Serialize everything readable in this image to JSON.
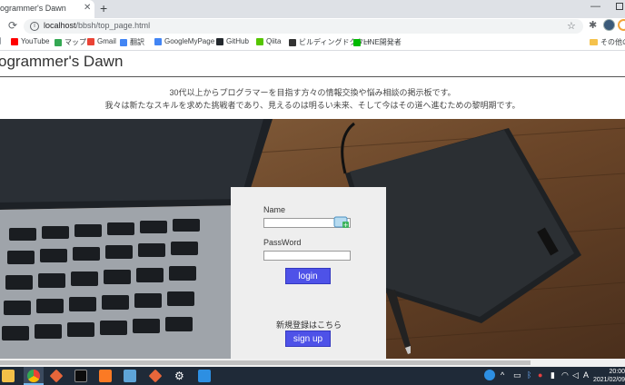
{
  "browser": {
    "tab_title": "ogrammer's Dawn",
    "tab_close": "✕",
    "new_tab": "+",
    "url_host": "localhost",
    "url_path": "/bbsh/top_page.html"
  },
  "bookmarks": [
    {
      "label": "YouTube",
      "icon_color": "#ff0000"
    },
    {
      "label": "マップ",
      "icon_color": "#34a853"
    },
    {
      "label": "Gmail",
      "icon_color": "#ea4335"
    },
    {
      "label": "翻訳",
      "icon_color": "#4285f4"
    },
    {
      "label": "GoogleMyPage",
      "icon_color": "#4285f4"
    },
    {
      "label": "GitHub",
      "icon_color": "#24292e"
    },
    {
      "label": "Qiita",
      "icon_color": "#55c500"
    },
    {
      "label": "ビルディングドクター",
      "icon_color": "#333333"
    },
    {
      "label": "LINE開発者",
      "icon_color": "#00b900"
    }
  ],
  "bookmarks_other": "その他のブ",
  "page": {
    "site_title": "ogrammer's Dawn",
    "tagline_1": "30代以上からプログラマーを目指す方々の情報交換や悩み相談の掲示板です。",
    "tagline_2": "我々は新たなスキルを求めた挑戦者であり、見えるのは明るい未来、そして今はその道へ進むための黎明期です。"
  },
  "login": {
    "name_label": "Name",
    "name_value": "",
    "password_label": "PassWord",
    "password_value": "",
    "login_button": "login",
    "register_text": "新規登録はこちら",
    "signup_button": "sign up",
    "button_color": "#4e52e8"
  },
  "taskbar": {
    "time": "20:00",
    "date": "2021/02/09"
  }
}
